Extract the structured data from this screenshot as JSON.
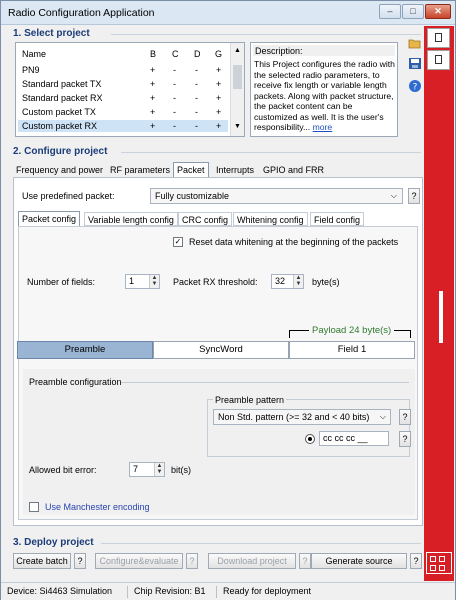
{
  "window": {
    "title": "Radio Configuration Application",
    "min": "–",
    "max": "□",
    "close": "✕"
  },
  "select_project": {
    "heading": "1. Select project",
    "columns": [
      "Name",
      "B",
      "C",
      "D",
      "G"
    ],
    "rows": [
      {
        "name": "PN9",
        "b": "+",
        "c": "-",
        "d": "-",
        "g": "+"
      },
      {
        "name": "Standard packet TX",
        "b": "+",
        "c": "-",
        "d": "-",
        "g": "+"
      },
      {
        "name": "Standard packet RX",
        "b": "+",
        "c": "-",
        "d": "-",
        "g": "+"
      },
      {
        "name": "Custom packet TX",
        "b": "+",
        "c": "-",
        "d": "-",
        "g": "+"
      },
      {
        "name": "Custom packet RX",
        "b": "+",
        "c": "-",
        "d": "-",
        "g": "+"
      }
    ],
    "description_label": "Description:",
    "description_text": "This Project configures the radio with the selected radio parameters, to receive fix length or variable length packets. Along with packet structure, the packet content can be customized as well. It is the user's responsibility...",
    "more_link": "more"
  },
  "configure_project": {
    "heading": "2. Configure project",
    "tabs": [
      "Frequency and power",
      "RF parameters",
      "Packet",
      "Interrupts",
      "GPIO and FRR"
    ],
    "predefined_label": "Use predefined packet:",
    "predefined_value": "Fully customizable",
    "help": "?",
    "subtabs": [
      "Packet config",
      "Variable length config",
      "CRC config",
      "Whitening config",
      "Field config"
    ],
    "reset_whitening_label": "Reset data whitening at the beginning of the packets",
    "reset_whitening_checked": true,
    "fields_label": "Number of fields:",
    "fields_value": "1",
    "rx_threshold_label": "Packet RX threshold:",
    "rx_threshold_value": "32",
    "rx_threshold_unit": "byte(s)",
    "payload_label": "Payload 24 byte(s)",
    "packet_parts": [
      "Preamble",
      "SyncWord",
      "Field 1"
    ],
    "preamble": {
      "group_label": "Preamble configuration",
      "pattern_label": "Preamble pattern",
      "pattern_value": "Non Std. pattern (>= 32 and < 40 bits)",
      "pattern_input": "cc  cc  cc  __",
      "bit_error_label": "Allowed bit error:",
      "bit_error_value": "7",
      "bit_error_unit": "bit(s)",
      "manchester_label": "Use Manchester encoding",
      "manchester_checked": false
    }
  },
  "deploy_project": {
    "heading": "3. Deploy project",
    "create_batch": "Create batch",
    "configure_evaluate": "Configure&evaluate",
    "download_project": "Download project",
    "generate_source": "Generate source",
    "help": "?"
  },
  "status_bar": {
    "device": "Device: Si4463  Simulation",
    "chip": "Chip Revision: B1",
    "state": "Ready for deployment"
  },
  "colors": {
    "accent_red": "#d81f26",
    "heading_blue": "#1a3c78",
    "payload_green": "#2f7a2f",
    "selected_row": "#cfe3f7",
    "active_bar": "#9ab5d4"
  }
}
